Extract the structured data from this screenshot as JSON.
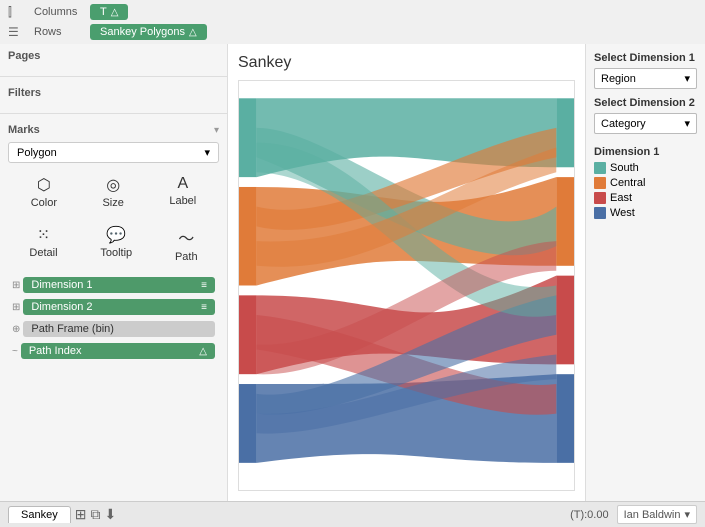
{
  "toolbar": {
    "columns_label": "Columns",
    "rows_label": "Rows",
    "columns_pill": "T",
    "rows_pill": "Sankey Polygons",
    "delta": "△"
  },
  "sidebar": {
    "pages_label": "Pages",
    "filters_label": "Filters",
    "marks_label": "Marks",
    "mark_type": "Polygon",
    "color_label": "Color",
    "size_label": "Size",
    "label_label": "Label",
    "detail_label": "Detail",
    "tooltip_label": "Tooltip",
    "path_label": "Path",
    "fields": [
      {
        "name": "Dimension 1",
        "type": "dim1",
        "prefix": "⊞"
      },
      {
        "name": "Dimension 2",
        "type": "dim2",
        "prefix": "⊞"
      },
      {
        "name": "Path Frame (bin)",
        "type": "path-frame",
        "prefix": "⊕"
      },
      {
        "name": "Path Index",
        "type": "path-index",
        "prefix": "~"
      }
    ]
  },
  "chart": {
    "title": "Sankey"
  },
  "right": {
    "dim1_label": "Select Dimension 1",
    "dim1_value": "Region",
    "dim2_label": "Select Dimension 2",
    "dim2_value": "Category",
    "legend_title": "Dimension 1",
    "legend_items": [
      {
        "label": "South",
        "color": "#5aafa2"
      },
      {
        "label": "Central",
        "color": "#e07b39"
      },
      {
        "label": "East",
        "color": "#c84b4b"
      },
      {
        "label": "West",
        "color": "#4a6fa5"
      }
    ]
  },
  "status": {
    "tab_name": "Sankey",
    "coordinates": "(T):0.00",
    "user": "Ian Baldwin"
  }
}
